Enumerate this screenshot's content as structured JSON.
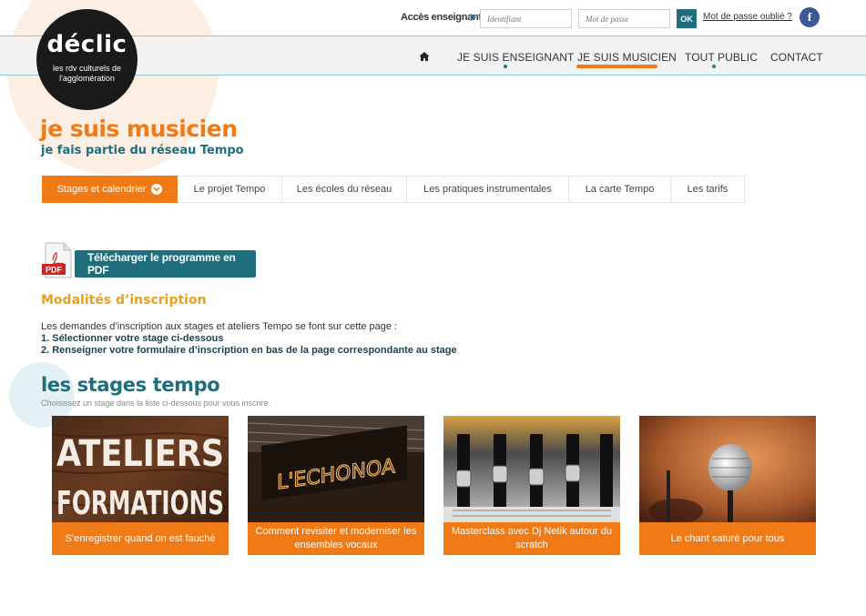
{
  "topbar": {
    "acces_label": "Accès enseignants",
    "ident_placeholder": "Identifiant",
    "pass_placeholder": "Mot de passe",
    "ok_label": "OK",
    "forgot_label": "Mot de passe oublié ?",
    "fb_label": "f"
  },
  "logo": {
    "word": "déclic",
    "sub_line1": "les rdv culturels de",
    "sub_line2": "l'agglomération"
  },
  "nav": {
    "items": [
      {
        "label": "JE SUIS ENSEIGNANT"
      },
      {
        "label": "JE SUIS MUSICIEN"
      },
      {
        "label": "TOUT PUBLIC"
      },
      {
        "label": "CONTACT"
      }
    ]
  },
  "hero": {
    "title": "je suis musicien",
    "subtitle": "je fais partie du réseau Tempo"
  },
  "tabs": [
    {
      "label": "Stages et calendrier"
    },
    {
      "label": "Le projet Tempo"
    },
    {
      "label": "Les écoles du réseau"
    },
    {
      "label": "Les pratiques instrumentales"
    },
    {
      "label": "La carte Tempo"
    },
    {
      "label": "Les tarifs"
    }
  ],
  "pdf": {
    "icon_label": "PDF",
    "button_label": "Télécharger le programme en PDF"
  },
  "inscription": {
    "title": "Modalités d’inscription",
    "intro": "Les demandes d’inscription aux stages et ateliers Tempo se font sur cette page :",
    "step1": "1. Sélectionner votre stage ci-dessous",
    "step2": "2. Renseigner votre formulaire d’inscription en bas de la page correspondante au stage"
  },
  "stages": {
    "title": "les stages tempo",
    "subtitle": "Choisissez un stage dans la liste ci-dessous pour vous inscrire.",
    "cards": [
      {
        "caption": "S’enregistrer quand on est fauché",
        "img_line1": "ATELIERS",
        "img_line2": "FORMATIONS"
      },
      {
        "caption": "Comment revisiter et moderniser les ensembles vocaux",
        "img_text": "L'ECHONOA"
      },
      {
        "caption": "Masterclass avec Dj Netik autour du scratch"
      },
      {
        "caption": "Le chant saturé pour tous"
      }
    ]
  },
  "colors": {
    "orange": "#f07a16",
    "teal": "#1e6e7e",
    "gold": "#e8a020",
    "facebook": "#3b5998"
  }
}
